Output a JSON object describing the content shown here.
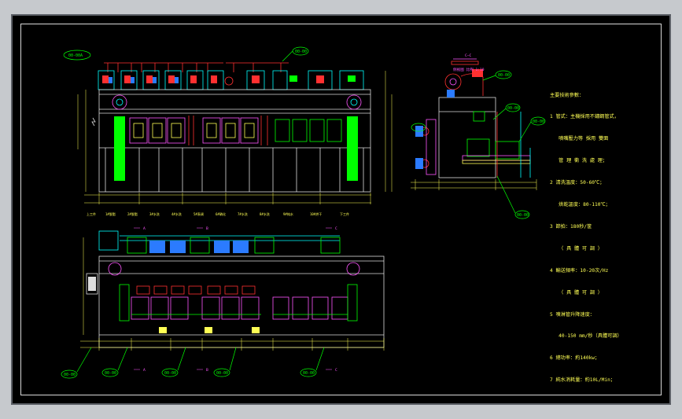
{
  "drawing": {
    "tags": {
      "frame_id": "00-00A",
      "top_top": "00-00",
      "side_top": "00-00",
      "side_right_1": "00-00",
      "side_right_2": "00-00",
      "side_bottom": "00-00",
      "plan_1": "00-00",
      "plan_2": "00-00",
      "plan_3": "00-00",
      "plan_4": "00-00",
      "plan_5": "00-00"
    },
    "section_title": "C—C",
    "section_subtitle": "侧视图 比例 1:10",
    "section_marks": [
      "A",
      "B",
      "C"
    ],
    "station_labels": [
      "上工件",
      "1#脱脂",
      "2#脱脂",
      "3#水洗",
      "4#水洗",
      "5#表调",
      "6#磷化",
      "7#水洗",
      "8#水洗",
      "9#纯水",
      "10#烘干",
      "下工件"
    ],
    "notes_title": "主要技術參數：",
    "notes": [
      "1 管式：主機採用不鏽鋼管式，",
      "   噴嘴壓力等 採用 雙面",
      "   管 理 衝 洗 處 理；",
      "2 清洗溫度：50-60℃；",
      "   烘乾溫度：80-110℃；",
      "3 節拍：180秒/筐",
      "   （ 具 體 可 調 ）",
      "4 輸送頻率：10-20次/Hz",
      "   （ 具 體 可 調 ）",
      "5 噴淋管升降速度：",
      "   40-150 mm/秒（具體可調）",
      "6 總功率：約140kw；",
      "7 純水消耗量：約10L/Min；"
    ]
  }
}
